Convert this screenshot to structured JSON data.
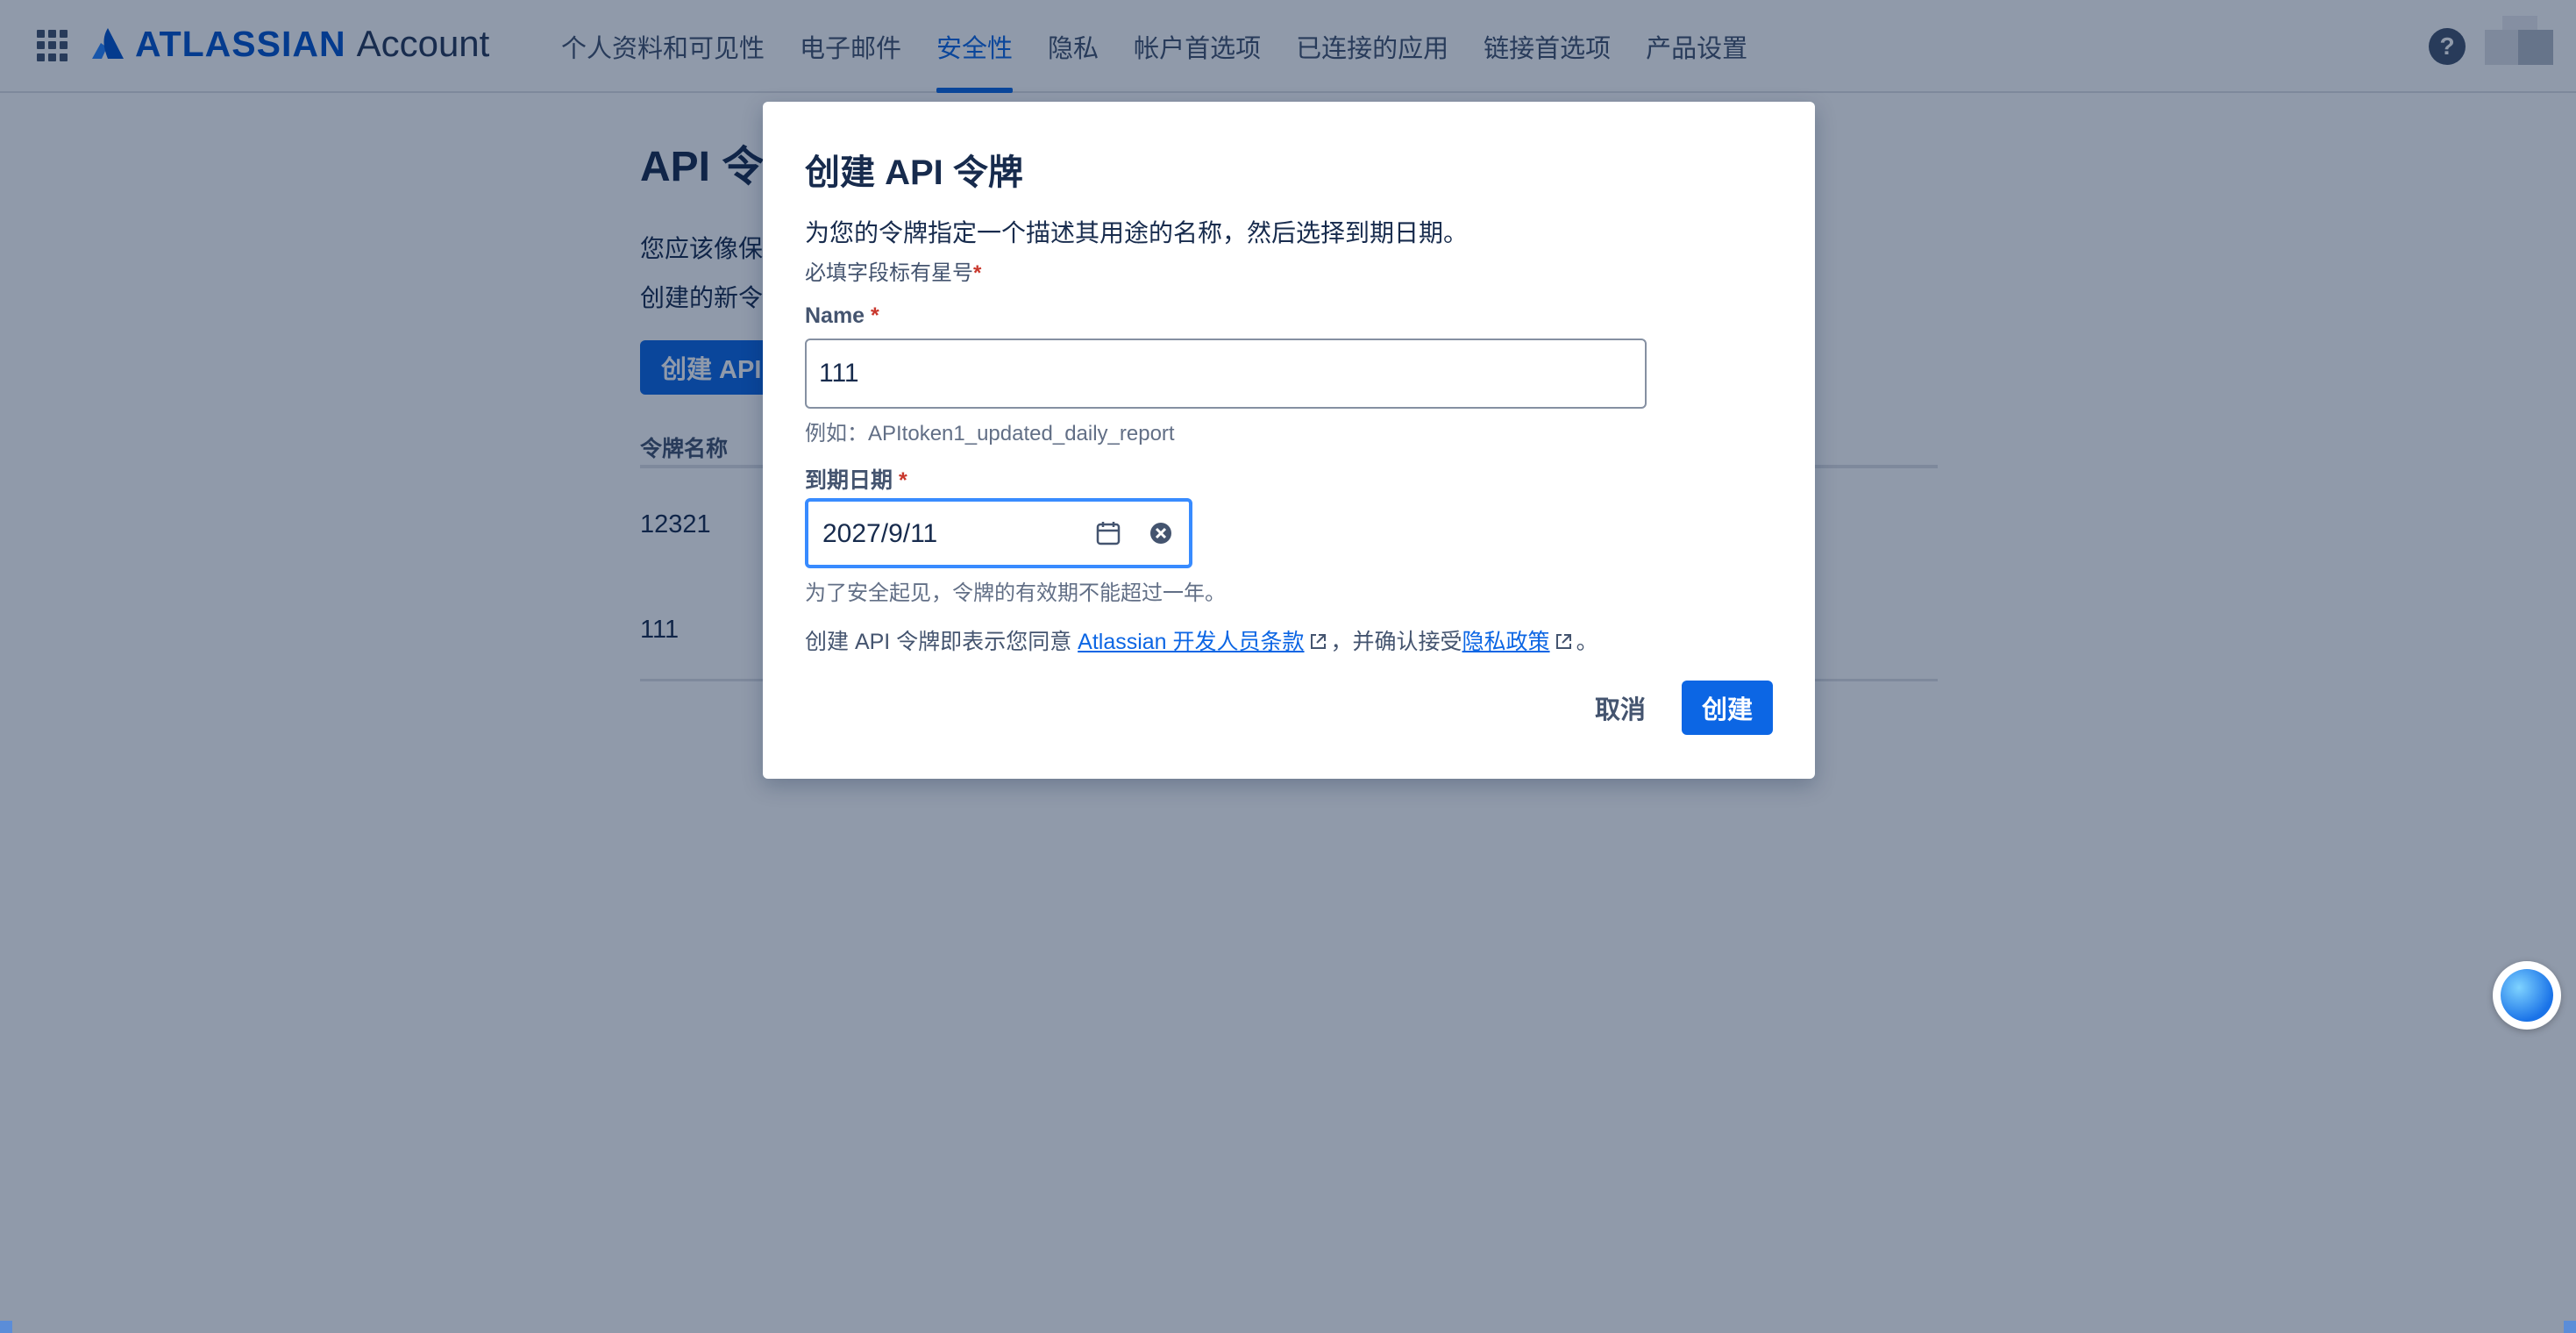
{
  "header": {
    "brand": "ATLASSIAN",
    "product": "Account",
    "tabs": [
      {
        "label": "个人资料和可见性"
      },
      {
        "label": "电子邮件"
      },
      {
        "label": "安全性",
        "active": true
      },
      {
        "label": "隐私"
      },
      {
        "label": "帐户首选项"
      },
      {
        "label": "已连接的应用"
      },
      {
        "label": "链接首选项"
      },
      {
        "label": "产品设置"
      }
    ],
    "help_label": "?"
  },
  "background": {
    "title": "API 令",
    "desc_line1": "您应该像保",
    "desc_line2": "创建的新令",
    "create_button": "创建 API",
    "column_header": "令牌名称",
    "rows": [
      "12321",
      "111"
    ]
  },
  "modal": {
    "title": "创建 API 令牌",
    "description": "为您的令牌指定一个描述其用途的名称，然后选择到期日期。",
    "required_note": "必填字段标有星号",
    "required_mark": "*",
    "name_label": "Name",
    "name_value": "111",
    "name_helper": "例如：APItoken1_updated_daily_report",
    "date_label": "到期日期",
    "date_value": "2027/9/11",
    "date_helper": "为了安全起见，令牌的有效期不能超过一年。",
    "terms_prefix": "创建 API 令牌即表示您同意 ",
    "terms_link1": "Atlassian 开发人员条款",
    "terms_middle": "，并确认接受",
    "terms_link2": "隐私政策",
    "terms_suffix": "。",
    "cancel_label": "取消",
    "create_label": "创建"
  },
  "colors": {
    "accent": "#0c66e4",
    "brand": "#0052cc",
    "required": "#c9372c",
    "focus_border": "#388bff"
  },
  "icons": [
    "app-switcher-icon",
    "atlassian-logo-icon",
    "help-icon",
    "calendar-icon",
    "clear-icon",
    "external-link-icon"
  ]
}
